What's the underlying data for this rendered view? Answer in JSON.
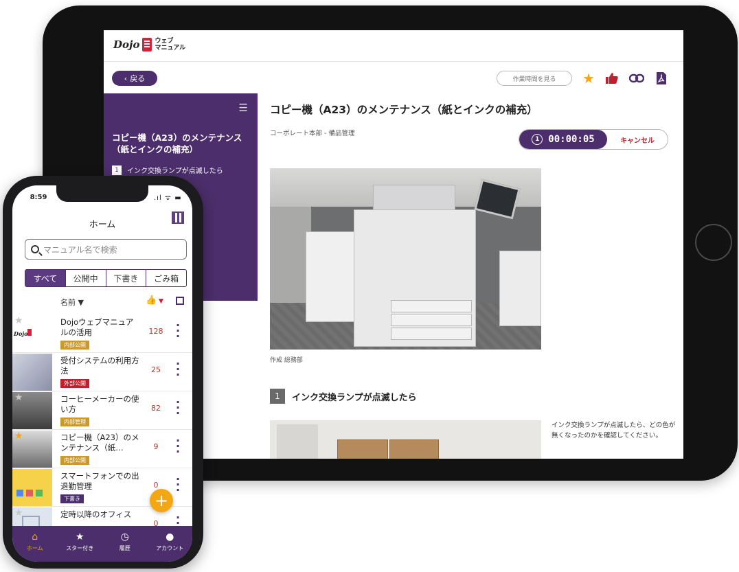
{
  "tablet": {
    "brand": {
      "logo_text": "Dojo",
      "logo_sub_line1": "ウェブ",
      "logo_sub_line2": "マニュアル"
    },
    "toolbar": {
      "back_label": "戻る",
      "worktime_label": "作業時間を見る",
      "icons": [
        "star-icon",
        "thumbs-up-icon",
        "link-icon",
        "pdf-icon"
      ],
      "icon_colors": {
        "star": "#F3A712",
        "thumbs_up": "#C0202E",
        "link": "#4B2E6B",
        "pdf": "#4B2E6B"
      }
    },
    "sidebar": {
      "title": "コピー機（A23）のメンテナンス（紙とインクの補充）",
      "steps": [
        {
          "number": "1",
          "label": "インク交換ランプが点滅したら"
        }
      ]
    },
    "main": {
      "title": "コピー機（A23）のメンテナンス（紙とインクの補充）",
      "breadcrumb": "コーポレート本部 - 備品管理",
      "timer": "00:00:05",
      "cancel_label": "キャンセル",
      "photo_caption": "作成 総務部",
      "step": {
        "number": "1",
        "title": "インク交換ランプが点滅したら",
        "description": "インク交換ランプが点滅したら、どの色が無くなったのかを確認してください。"
      }
    }
  },
  "phone": {
    "status_time": "8:59",
    "title": "ホーム",
    "search_placeholder": "マニュアル名で検索",
    "tabs": [
      "すべて",
      "公開中",
      "下書き",
      "ごみ箱"
    ],
    "active_tab": "すべて",
    "sort_label": "名前 ▼",
    "items": [
      {
        "title": "Dojoウェブマニュアルの活用",
        "badge": "内部公開",
        "count": "128",
        "starred": false
      },
      {
        "title": "受付システムの利用方法",
        "badge": "外部公開",
        "count": "25",
        "starred": false
      },
      {
        "title": "コーヒーメーカーの使い方",
        "badge": "内部管理",
        "count": "82",
        "starred": false
      },
      {
        "title": "コピー機（A23）のメンテナンス（紙…",
        "badge": "内部公開",
        "count": "9",
        "starred": true
      },
      {
        "title": "スマートフォンでの出退勤管理",
        "badge": "下書き",
        "count": "0",
        "starred": false
      },
      {
        "title": "定時以降のオフィス",
        "badge": "",
        "count": "0",
        "starred": false
      }
    ],
    "badge_colors": {
      "内部公開": "#C99A2E",
      "外部公開": "#C0202E",
      "内部管理": "#C99A2E",
      "下書き": "#4B2E6B"
    },
    "fab_label": "+",
    "nav": [
      "ホーム",
      "スター付き",
      "履歴",
      "アカウント"
    ],
    "active_nav": "ホーム",
    "accent": "#4B2E6B",
    "highlight": "#F3A712"
  }
}
